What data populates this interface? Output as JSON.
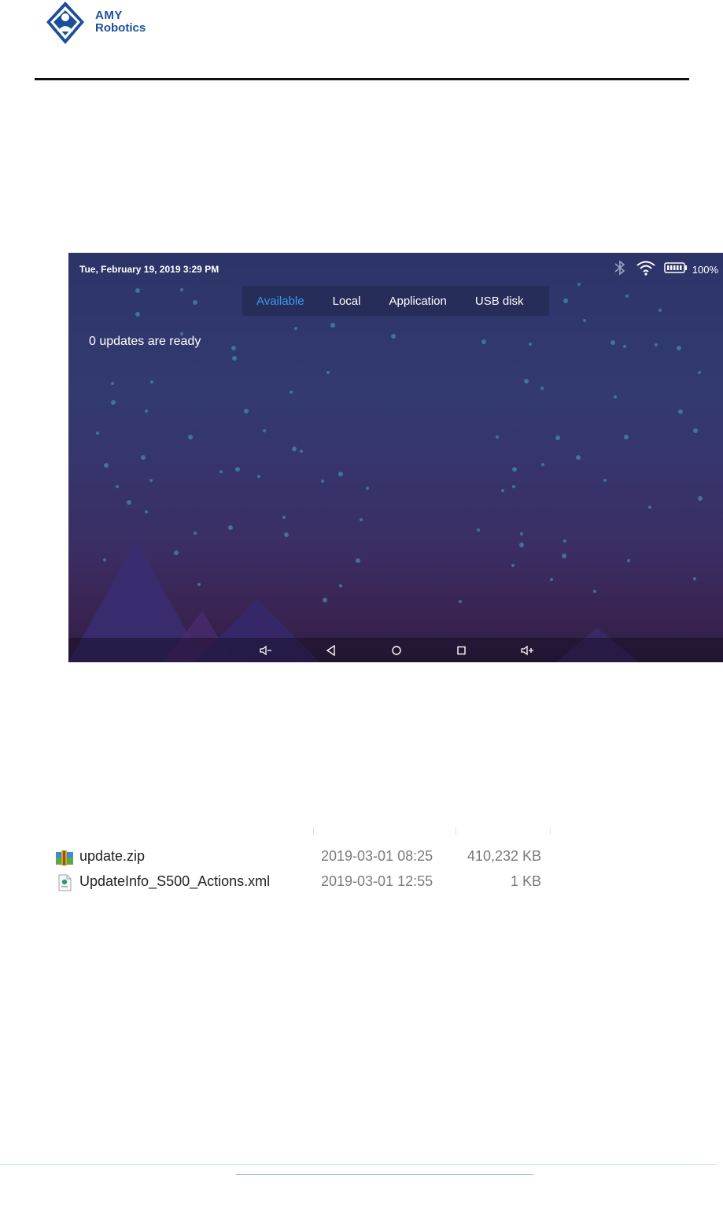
{
  "header": {
    "logo_line1": "AMY",
    "logo_line2": "Robotics",
    "logo_color": "#1b4f9a"
  },
  "device": {
    "status": {
      "datetime": "Tue, February 19, 2019 3:29  PM",
      "battery_percent": "100%",
      "icons": [
        "bluetooth-icon",
        "wifi-icon",
        "battery-icon"
      ]
    },
    "tabs": [
      {
        "label": "Available",
        "active": true
      },
      {
        "label": "Local",
        "active": false
      },
      {
        "label": "Application",
        "active": false
      },
      {
        "label": "USB disk",
        "active": false
      }
    ],
    "message": "0 updates are ready",
    "nav_buttons": [
      "volume-down-icon",
      "back-icon",
      "home-icon",
      "recents-icon",
      "volume-up-icon"
    ],
    "accent_color": "#3a9bf2"
  },
  "files": [
    {
      "name": "update.zip",
      "date": "2019-03-01 08:25",
      "size": "410,232 KB",
      "icon": "zip-archive-icon"
    },
    {
      "name": "UpdateInfo_S500_Actions.xml",
      "date": "2019-03-01 12:55",
      "size": "1 KB",
      "icon": "xml-file-icon"
    }
  ]
}
